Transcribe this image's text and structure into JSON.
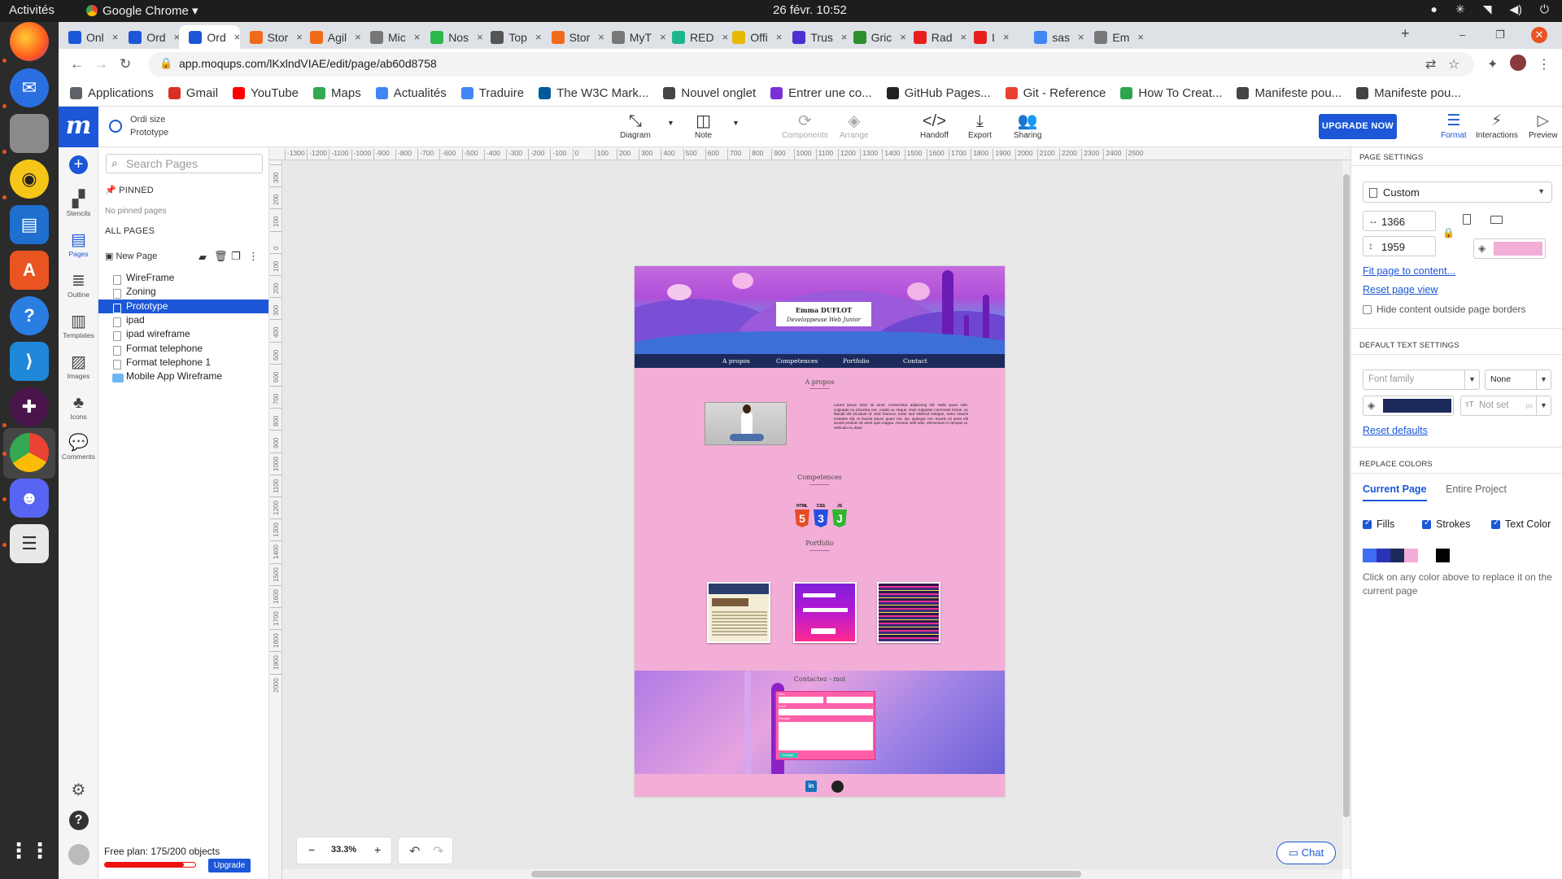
{
  "os": {
    "activities": "Activités",
    "app_name": "Google Chrome",
    "clock": "26 févr.  10:52"
  },
  "browser": {
    "tabs": [
      {
        "label": "Onl",
        "fav": "#1b57d6"
      },
      {
        "label": "Ord",
        "fav": "#1b57d6"
      },
      {
        "label": "Ord",
        "fav": "#1b57d6",
        "active": true
      },
      {
        "label": "Stor",
        "fav": "#f06a1b"
      },
      {
        "label": "Agil",
        "fav": "#f06a1b"
      },
      {
        "label": "Mic",
        "fav": "#777777"
      },
      {
        "label": "Nos",
        "fav": "#2db84a"
      },
      {
        "label": "Top",
        "fav": "#555555"
      },
      {
        "label": "Stor",
        "fav": "#f06a1b"
      },
      {
        "label": "MyT",
        "fav": "#777777"
      },
      {
        "label": "RED",
        "fav": "#1fb58f"
      },
      {
        "label": "Offi",
        "fav": "#e6b800"
      },
      {
        "label": "Trus",
        "fav": "#4b2fd1"
      },
      {
        "label": "Gric",
        "fav": "#2c8f2c"
      },
      {
        "label": "Rad",
        "fav": "#e81e1e"
      },
      {
        "label": "I",
        "fav": "#e81e1e"
      },
      {
        "label": "sas",
        "fav": "#4285f4"
      },
      {
        "label": "Em",
        "fav": "#777777"
      }
    ],
    "new_tab": "+",
    "url": "app.moqups.com/lKxlndVIAE/edit/page/ab60d8758",
    "bookmarks": [
      {
        "label": "Applications",
        "color": "#5f6368"
      },
      {
        "label": "Gmail",
        "color": "#d93025"
      },
      {
        "label": "YouTube",
        "color": "#ff0000"
      },
      {
        "label": "Maps",
        "color": "#34a853"
      },
      {
        "label": "Actualités",
        "color": "#4285f4"
      },
      {
        "label": "Traduire",
        "color": "#4285f4"
      },
      {
        "label": "The W3C Mark...",
        "color": "#005a9c"
      },
      {
        "label": "Nouvel onglet",
        "color": "#444444"
      },
      {
        "label": "Entrer une co...",
        "color": "#7b2fd6"
      },
      {
        "label": "GitHub Pages...",
        "color": "#222222"
      },
      {
        "label": "Git - Reference",
        "color": "#e8412f"
      },
      {
        "label": "How To Creat...",
        "color": "#2ea44f"
      },
      {
        "label": "Manifeste pou...",
        "color": "#444444"
      },
      {
        "label": "Manifeste pou...",
        "color": "#444444"
      }
    ]
  },
  "app": {
    "logo": "m",
    "project_name": "Ordi size",
    "page_name": "Prototype",
    "toolbar": {
      "diagram": "Diagram",
      "note": "Note",
      "components": "Components",
      "arrange": "Arrange",
      "handoff": "Handoff",
      "export": "Export",
      "sharing": "Sharing",
      "upgrade_now": "UPGRADE NOW",
      "format": "Format",
      "interactions": "Interactions",
      "preview": "Preview"
    },
    "rail": {
      "stencils": "Stencils",
      "pages": "Pages",
      "outline": "Outline",
      "templates": "Templates",
      "images": "Images",
      "icons": "Icons",
      "comments": "Comments"
    },
    "pages_panel": {
      "search_placeholder": "Search Pages",
      "pinned": "PINNED",
      "no_pinned": "No pinned pages",
      "all_pages": "ALL PAGES",
      "new_page": "New Page",
      "items": [
        {
          "label": "WireFrame"
        },
        {
          "label": "Zoning"
        },
        {
          "label": "Prototype",
          "selected": true
        },
        {
          "label": "ipad"
        },
        {
          "label": "ipad wireframe"
        },
        {
          "label": "Format telephone"
        },
        {
          "label": "Format telephone 1"
        },
        {
          "label": "Mobile App Wireframe",
          "folder": true
        }
      ],
      "plan_label": "Free plan: 175/200 objects",
      "plan_fraction": 0.875,
      "upgrade": "Upgrade"
    },
    "canvas": {
      "ruler_top": [
        "-1300",
        "-1200",
        "-1100",
        "-1000",
        "-900",
        "-800",
        "-700",
        "-600",
        "-500",
        "-400",
        "-300",
        "-200",
        "-100",
        "0",
        "100",
        "200",
        "300",
        "400",
        "500",
        "600",
        "700",
        "800",
        "900",
        "1000",
        "1100",
        "1200",
        "1300",
        "1400",
        "1500",
        "1600",
        "1700",
        "1800",
        "1900",
        "2000",
        "2100",
        "2200",
        "2300",
        "2400",
        "2500"
      ],
      "ruler_left": [
        "300",
        "200",
        "100",
        "0",
        "100",
        "200",
        "300",
        "400",
        "500",
        "600",
        "700",
        "800",
        "900",
        "1000",
        "1100",
        "1200",
        "1300",
        "1400",
        "1500",
        "1600",
        "1700",
        "1800",
        "1900",
        "2000"
      ],
      "zoom": "33.3%",
      "zoom_minus": "−",
      "zoom_plus": "+",
      "chat": "Chat"
    },
    "artboard": {
      "name": "Emma DUFLOT",
      "role": "Developpeuse Web Junior",
      "nav": [
        "A propos",
        "Competences",
        "Portfolio",
        "Contact"
      ],
      "about_title": "A propos",
      "lorem": "Lorem ipsum dolor sit amet, consectetur adipiscing elit. Nulla quam velit, vulputate eu pharetra nec, mattis ac neque. Duis vulputate commodo lectus, ac blandit elit tincidunt id. Sed rhoncus, tortor sed eleifend tristique, tortor mauris molestie elit, et lacinia ipsum quam nec dui. Quisque nec mauris sit amet elit iaculis pretium sit amet quis magna. Aenean velit odio, elementum in tempus ut, vehicula eu diam.",
      "skills_title": "Competences",
      "badges": [
        {
          "label": "HTML",
          "glyph": "5",
          "color": "#e44d26"
        },
        {
          "label": "CSS",
          "glyph": "3",
          "color": "#264de4"
        },
        {
          "label": "JS",
          "glyph": "J",
          "color": "#2fb52f"
        }
      ],
      "portfolio_title": "Portfolio",
      "contact_title": "Contactez - moi",
      "form_labels": [
        "Nom",
        "Email",
        "Message"
      ],
      "send": "Envoyer"
    },
    "right_panel": {
      "page_settings": "PAGE SETTINGS",
      "size_preset": "Custom",
      "width": "1366",
      "height": "1959",
      "page_color": "#f2aed6",
      "fit_link": "Fit page to content...",
      "reset_view": "Reset page view",
      "hide_outside": "Hide content outside page borders",
      "default_text": "DEFAULT TEXT SETTINGS",
      "font_family_placeholder": "Font family",
      "font_style": "None",
      "text_color": "#1c2a5c",
      "size_placeholder": "Not set",
      "size_unit": "px",
      "reset_defaults": "Reset defaults",
      "replace_colors": "REPLACE COLORS",
      "tab_current": "Current Page",
      "tab_entire": "Entire Project",
      "fills": "Fills",
      "strokes": "Strokes",
      "text_color_label": "Text Color",
      "swatches": [
        "#3d6ff0",
        "#2a33b5",
        "#1c2a5c",
        "#f2aed6"
      ],
      "swatch_black": "#000000",
      "hint": "Click on any color above to replace it on the current page"
    }
  }
}
